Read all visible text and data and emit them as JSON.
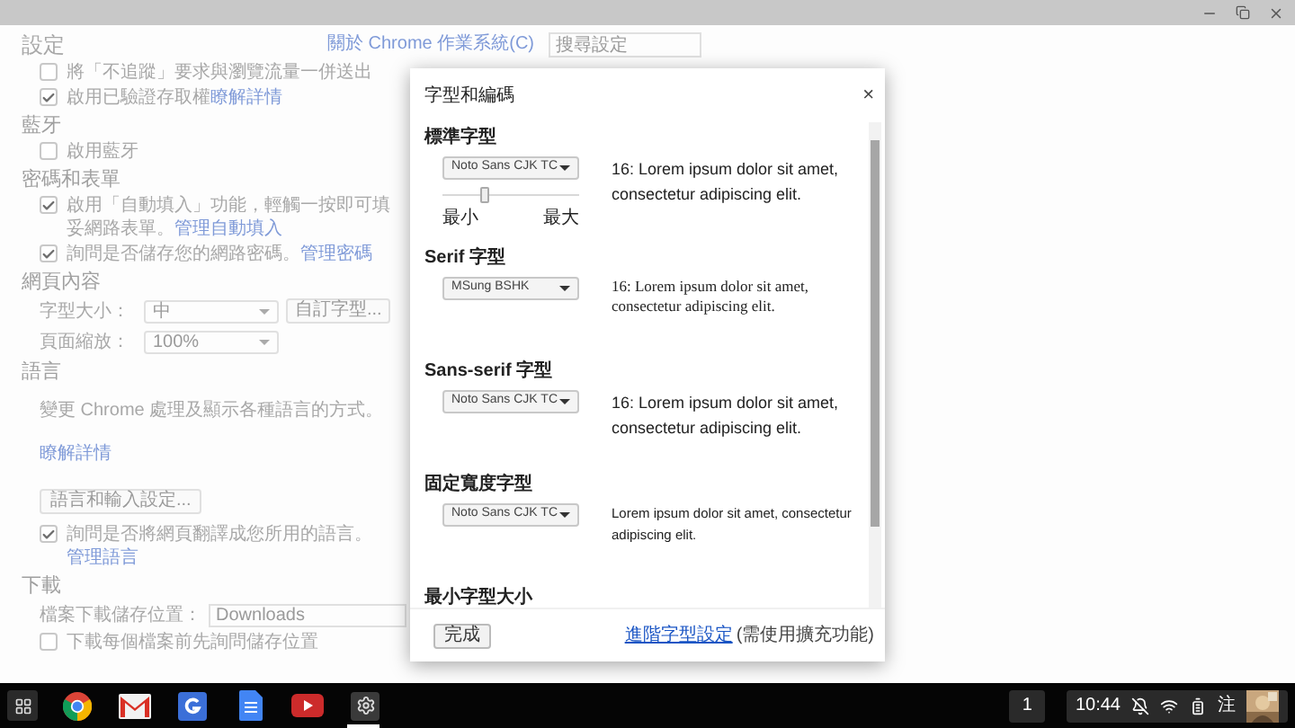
{
  "settings": {
    "title": "設定",
    "about_link": "關於 Chrome 作業系統(C)",
    "search": {
      "placeholder": "搜尋設定"
    },
    "sections": [
      {
        "items": [
          {
            "kind": "checkbox",
            "label": "將「不追蹤」要求與瀏覽流量一併送出",
            "checked": false
          },
          {
            "kind": "checkbox",
            "label": "啟用已驗證存取權",
            "checked": true,
            "link": "瞭解詳情"
          }
        ]
      },
      {
        "title": "藍牙",
        "items": [
          {
            "kind": "checkbox",
            "label": "啟用藍牙",
            "checked": false
          }
        ]
      },
      {
        "title": "密碼和表單",
        "items": [
          {
            "kind": "checkbox",
            "label": "啟用「自動填入」功能，輕觸一按即可填妥網路表單。",
            "checked": true,
            "link": "管理自動填入"
          },
          {
            "kind": "checkbox",
            "label": "詢問是否儲存您的網路密碼。",
            "checked": true,
            "link": "管理密碼"
          }
        ]
      },
      {
        "title": "網頁內容",
        "items": [
          {
            "kind": "select",
            "label": "字型大小：",
            "value": "中",
            "button": "自訂字型..."
          },
          {
            "kind": "select",
            "label": "頁面縮放：",
            "value": "100%"
          }
        ]
      },
      {
        "title": "語言",
        "items": [
          {
            "kind": "text",
            "label": "變更 Chrome 處理及顯示各種語言的方式。",
            "link": "瞭解詳情"
          },
          {
            "kind": "button",
            "label": "語言和輸入設定..."
          },
          {
            "kind": "checkbox",
            "label": "詢問是否將網頁翻譯成您所用的語言。",
            "checked": true,
            "link": "管理語言"
          }
        ]
      },
      {
        "title": "下載",
        "items": [
          {
            "kind": "path",
            "label": "檔案下載儲存位置：",
            "value": "Downloads"
          },
          {
            "kind": "checkbox",
            "label": "下載每個檔案前先詢問儲存位置",
            "checked": false
          }
        ]
      }
    ]
  },
  "dialog": {
    "title": "字型和編碼",
    "close": "×",
    "sections": [
      {
        "kind": "standard",
        "title": "標準字型",
        "select": "Noto Sans CJK TC",
        "slider": {
          "level": 0.3,
          "min_label": "最小",
          "max_label": "最大"
        },
        "preview": "16: Lorem ipsum dolor sit amet, consectetur adipiscing elit."
      },
      {
        "kind": "serif",
        "title": "Serif 字型",
        "select": "MSung BSHK",
        "preview": "16: Lorem ipsum dolor sit amet, consectetur adipiscing elit."
      },
      {
        "kind": "sans",
        "title": "Sans-serif 字型",
        "select": "Noto Sans CJK TC",
        "preview": "16: Lorem ipsum dolor sit amet, consectetur adipiscing elit."
      },
      {
        "kind": "fixed",
        "title": "固定寬度字型",
        "select": "Noto Sans CJK TC",
        "preview": "Lorem ipsum dolor sit amet, consectetur adipiscing elit."
      },
      {
        "kind": "heading",
        "title": "最小字型大小"
      }
    ],
    "done_button": "完成",
    "advanced_link": "進階字型設定",
    "advanced_note": "(需使用擴充功能)"
  },
  "shelf": {
    "apps": [
      {
        "kind": "chrome",
        "active": false
      },
      {
        "kind": "gmail",
        "active": false
      },
      {
        "kind": "google",
        "active": false
      },
      {
        "kind": "docs",
        "active": false
      },
      {
        "kind": "youtube",
        "active": false
      },
      {
        "kind": "settings",
        "active": true
      }
    ],
    "notifications": "1",
    "time": "10:44",
    "ime": "注"
  }
}
